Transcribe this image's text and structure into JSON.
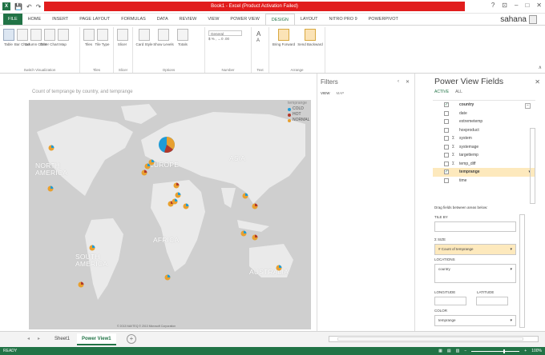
{
  "window": {
    "title": "Book1 - Excel (Product Activation Failed)",
    "user": "sahana",
    "controls": [
      "?",
      "⊡",
      "–",
      "□",
      "✕"
    ]
  },
  "ribbon_tabs": [
    "FILE",
    "HOME",
    "INSERT",
    "PAGE LAYOUT",
    "FORMULAS",
    "DATA",
    "REVIEW",
    "VIEW",
    "POWER VIEW",
    "DESIGN",
    "LAYOUT",
    "NITRO PRO 9",
    "POWERPIVOT"
  ],
  "ribbon": {
    "switch_visualization": {
      "label": "Switch Visualization",
      "buttons": [
        "Table",
        "Bar Chart",
        "Column Chart",
        "Other Chart",
        "Map"
      ]
    },
    "tiles": {
      "label": "Tiles",
      "buttons": [
        "Tiles",
        "Tile Type"
      ]
    },
    "slicer": {
      "label": "Slicer",
      "buttons": [
        "Slicer"
      ]
    },
    "options": {
      "label": "Options",
      "buttons": [
        "Card Style",
        "Show Levels",
        "Totals"
      ]
    },
    "number": {
      "label": "Number",
      "format": "General"
    },
    "text": {
      "label": "Text",
      "buttons": [
        "A",
        "A"
      ]
    },
    "arrange": {
      "label": "Arrange",
      "buttons": [
        "Bring Forward",
        "Send Backward"
      ]
    }
  },
  "map": {
    "title": "Count of temprange by country, and temprange",
    "legend_title": "temprange",
    "legend": [
      {
        "label": "COLD",
        "color": "#1f9bd6"
      },
      {
        "label": "HOT",
        "color": "#b2382a"
      },
      {
        "label": "NORMAL",
        "color": "#e8a030"
      }
    ],
    "labels": {
      "north_america": "NORTH\nAMERICA",
      "europe": "EUROPE",
      "asia": "ASIA",
      "africa": "AFRICA",
      "south_america": "SOUTH\nAMERICA",
      "australia": "AUSTRALIA"
    }
  },
  "filters": {
    "title": "Filters",
    "tabs": [
      "VIEW",
      "MAP"
    ]
  },
  "fields_panel": {
    "title": "Power View Fields",
    "tabs": [
      "ACTIVE",
      "ALL"
    ],
    "fields": [
      {
        "name": "country",
        "checked": true,
        "sigma": false,
        "bold": true
      },
      {
        "name": "date",
        "checked": false,
        "sigma": false
      },
      {
        "name": "extremetemp",
        "checked": false,
        "sigma": false
      },
      {
        "name": "hoxproduct",
        "checked": false,
        "sigma": false
      },
      {
        "name": "system",
        "checked": false,
        "sigma": true
      },
      {
        "name": "systemage",
        "checked": false,
        "sigma": true
      },
      {
        "name": "targettemp",
        "checked": false,
        "sigma": true
      },
      {
        "name": "temp_diff",
        "checked": false,
        "sigma": true
      },
      {
        "name": "temprange",
        "checked": true,
        "sigma": false,
        "bold": true,
        "highlight": true
      },
      {
        "name": "time",
        "checked": false,
        "sigma": false
      }
    ],
    "drag_note": "Drag fields between areas below:",
    "tile_by": "TILE BY",
    "size": "Σ SIZE",
    "size_value": "# Count of temprange",
    "locations": "LOCATIONS",
    "locations_value": "country",
    "longitude": "LONGITUDE",
    "latitude": "LATITUDE",
    "color": "COLOR",
    "color_value": "temprange"
  },
  "sheets": {
    "tabs": [
      "Sheet1",
      "Power View1"
    ],
    "active": "Power View1",
    "add": "+"
  },
  "status": {
    "ready": "READY",
    "zoom": "100%"
  }
}
